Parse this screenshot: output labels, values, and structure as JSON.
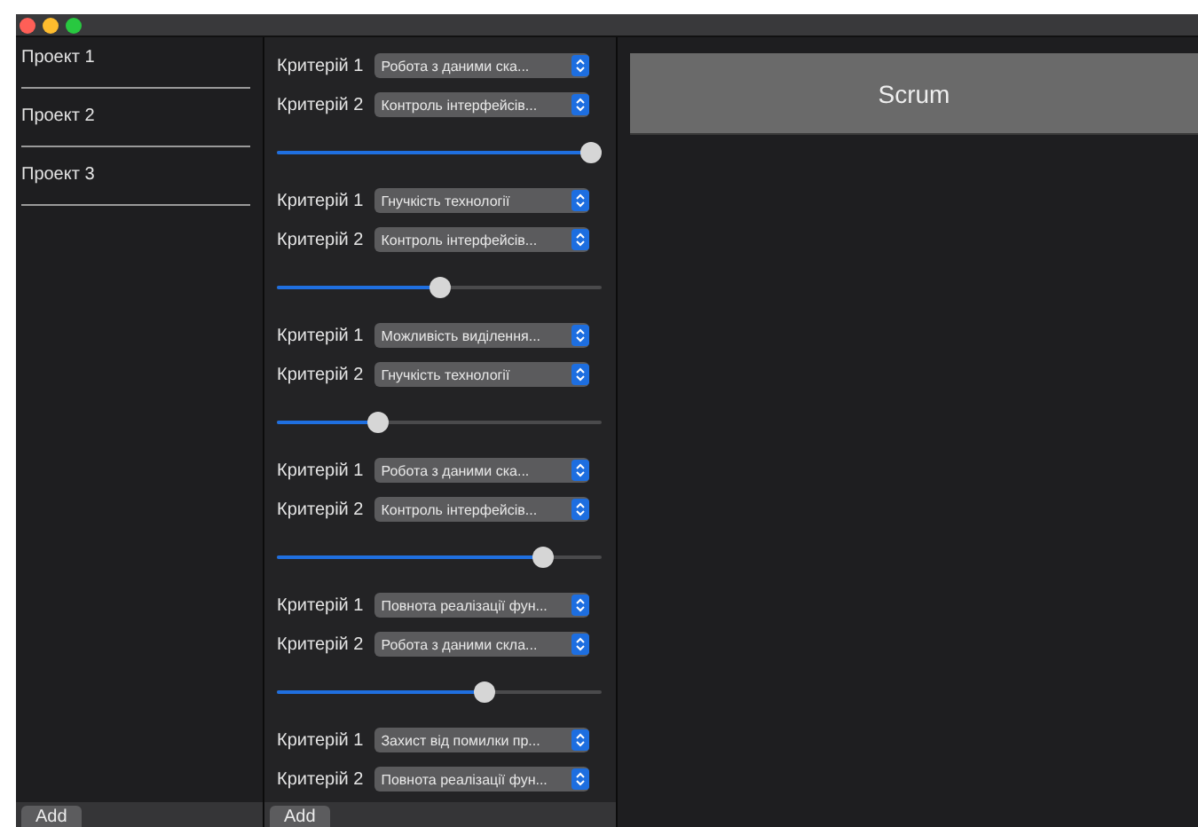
{
  "projects": [
    {
      "label": "Проект 1",
      "selected": false
    },
    {
      "label": "Проект 2",
      "selected": false
    },
    {
      "label": "Проект 3",
      "selected": false
    }
  ],
  "criteria_groups": [
    {
      "rows": [
        {
          "label": "Критерій 1",
          "value": "Робота з даними ска..."
        },
        {
          "label": "Критерій 2",
          "value": "Контроль інтерфейсів..."
        }
      ],
      "level": 1.0
    },
    {
      "rows": [
        {
          "label": "Критерій 1",
          "value": "Гнучкість технології"
        },
        {
          "label": "Критерій 2",
          "value": "Контроль інтерфейсів..."
        }
      ],
      "level": 0.5
    },
    {
      "rows": [
        {
          "label": "Критерій 1",
          "value": "Можливість виділення..."
        },
        {
          "label": "Критерій 2",
          "value": "Гнучкість технології"
        }
      ],
      "level": 0.3
    },
    {
      "rows": [
        {
          "label": "Критерій 1",
          "value": "Робота з даними ска..."
        },
        {
          "label": "Критерій 2",
          "value": "Контроль інтерфейсів..."
        }
      ],
      "level": 0.84
    },
    {
      "rows": [
        {
          "label": "Критерій 1",
          "value": "Повнота реалізації фун..."
        },
        {
          "label": "Критерій 2",
          "value": "Робота з даними скла..."
        }
      ],
      "level": 0.65
    },
    {
      "rows": [
        {
          "label": "Критерій 1",
          "value": "Захист від помилки пр..."
        },
        {
          "label": "Критерій 2",
          "value": "Повнота реалізації фун..."
        }
      ]
    }
  ],
  "result": {
    "label": "Scrum"
  },
  "left_footer": {
    "button": "Add"
  },
  "middle_footer": {
    "button": "Add"
  }
}
